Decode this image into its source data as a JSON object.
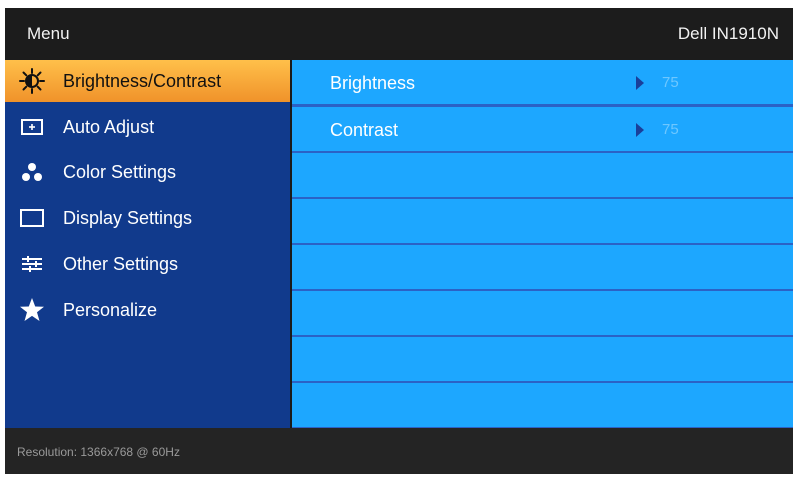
{
  "header": {
    "title": "Menu",
    "model": "Dell IN1910N"
  },
  "sidebar": {
    "items": [
      {
        "label": "Brightness/Contrast",
        "icon": "brightness-icon",
        "selected": true
      },
      {
        "label": "Auto Adjust",
        "icon": "auto-adjust-icon",
        "selected": false
      },
      {
        "label": "Color Settings",
        "icon": "color-settings-icon",
        "selected": false
      },
      {
        "label": "Display Settings",
        "icon": "display-settings-icon",
        "selected": false
      },
      {
        "label": "Other Settings",
        "icon": "other-settings-icon",
        "selected": false
      },
      {
        "label": "Personalize",
        "icon": "star-icon",
        "selected": false
      }
    ]
  },
  "content": {
    "rows": [
      {
        "label": "Brightness",
        "value": "75"
      },
      {
        "label": "Contrast",
        "value": "75"
      }
    ]
  },
  "footer": {
    "resolution": "Resolution: 1366x768 @ 60Hz"
  },
  "colors": {
    "sidebar": "#113a8c",
    "selected": "#f4a436",
    "row": "#1da7ff",
    "row_separator": "#2b62c6",
    "header": "#1c1c1c"
  }
}
